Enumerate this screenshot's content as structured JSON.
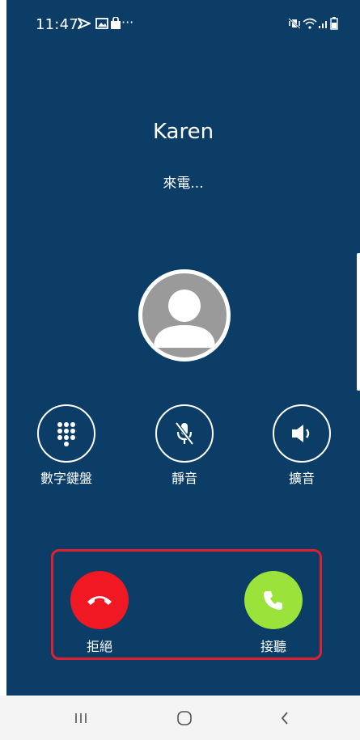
{
  "status_bar": {
    "time": "11:47",
    "more": "···"
  },
  "call": {
    "caller_name": "Karen",
    "status": "來電..."
  },
  "controls": {
    "keypad_label": "數字鍵盤",
    "mute_label": "靜音",
    "speaker_label": "擴音"
  },
  "actions": {
    "decline_label": "拒絕",
    "answer_label": "接聽"
  },
  "colors": {
    "background": "#0b3d66",
    "decline": "#f01822",
    "answer": "#9be33a",
    "highlight": "#e02030"
  }
}
